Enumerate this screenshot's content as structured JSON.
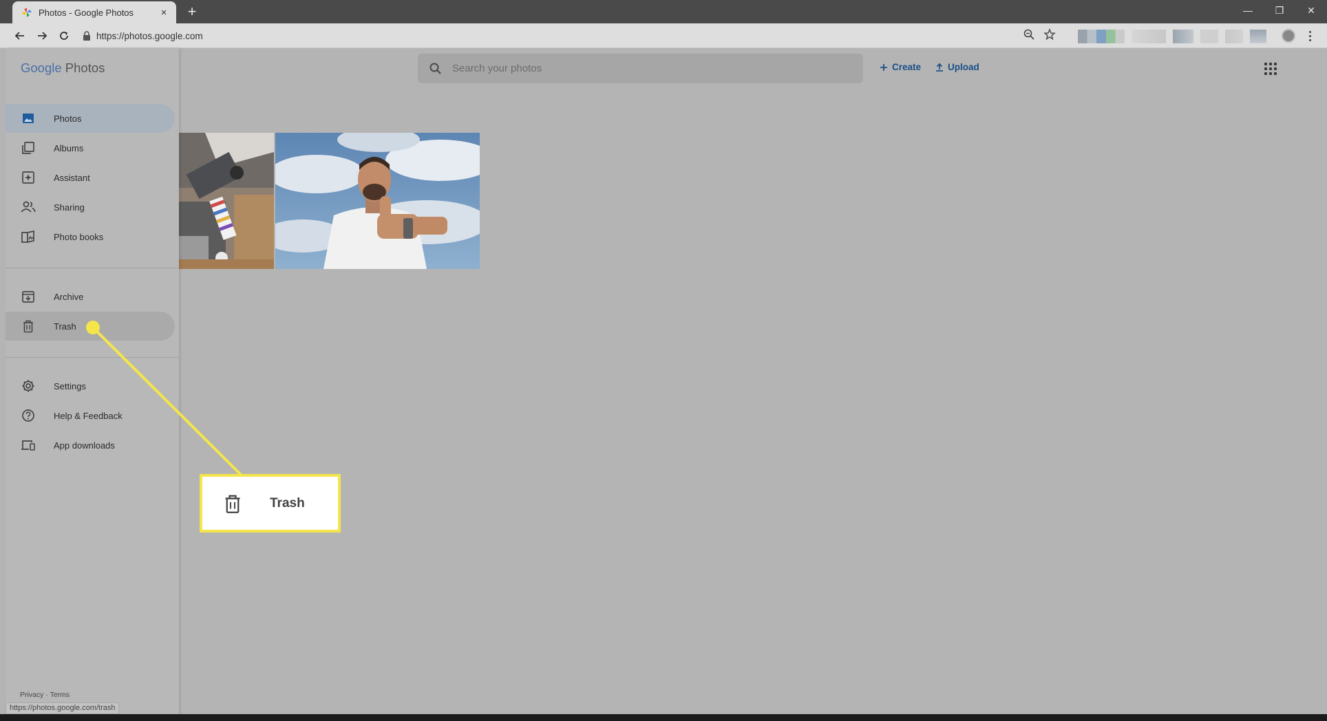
{
  "browser": {
    "tab_title": "Photos - Google Photos",
    "tab_close": "×",
    "new_tab": "+",
    "url": "https://photos.google.com",
    "status_url": "https://photos.google.com/trash",
    "window_controls": [
      "—",
      "❐",
      "✕"
    ]
  },
  "header": {
    "search_placeholder": "Search your photos",
    "create_label": "Create",
    "upload_label": "Upload"
  },
  "sidebar": {
    "logo_google": "Google",
    "logo_photos": "Photos",
    "items": [
      {
        "label": "Photos",
        "icon": "photo-icon"
      },
      {
        "label": "Albums",
        "icon": "albums-icon"
      },
      {
        "label": "Assistant",
        "icon": "assistant-icon"
      },
      {
        "label": "Sharing",
        "icon": "sharing-icon"
      },
      {
        "label": "Photo books",
        "icon": "photo-books-icon"
      },
      {
        "label": "Archive",
        "icon": "archive-icon"
      },
      {
        "label": "Trash",
        "icon": "trash-icon"
      },
      {
        "label": "Settings",
        "icon": "gear-icon"
      },
      {
        "label": "Help & Feedback",
        "icon": "help-icon"
      },
      {
        "label": "App downloads",
        "icon": "devices-icon"
      }
    ],
    "footer_privacy": "Privacy",
    "footer_sep": "·",
    "footer_terms": "Terms"
  },
  "callout": {
    "label": "Trash",
    "icon": "trash-icon",
    "color": "#f4e64a"
  },
  "colors": {
    "accent": "#1a4f88",
    "highlight": "#f4e64a"
  }
}
